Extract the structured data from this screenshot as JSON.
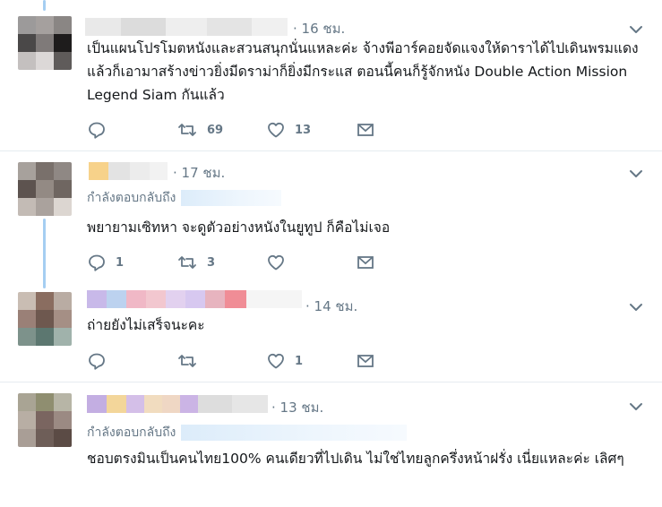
{
  "tweets": [
    {
      "time": "· 16 ชม.",
      "text": "เป็นแผนโปรโมตหนังและสวนสนุกนั่นแหละค่ะ จ้างพีอาร์คอยจัดแจงให้ดาราได้ไปเดินพรมแดง แล้วก็เอามาสร้างข่าวยิ่งมีดราม่าก็ยิ่งมีกระแส ตอนนี้คนก็รู้จักหนัง Double Action Mission Legend Siam กันแล้ว",
      "reply_to": "",
      "replies": "",
      "retweets": "69",
      "likes": "13",
      "avatar": [
        "#9c9a9a",
        "#a5a09e",
        "#8a8684",
        "#4a4848",
        "#7f7a79",
        "#1e1c1c",
        "#c4c0bf",
        "#dcd8d7",
        "#5f5b5a"
      ],
      "name_colors": [
        "#e9e9e9",
        "#dcdcdc",
        "#eeeeee",
        "#e4e4e4",
        "#f0f0f0"
      ]
    },
    {
      "time": "· 17 ชม.",
      "text": "พยายามเซิทหา จะดูตัวอย่างหนังในยูทูป ก็คือไม่เจอ",
      "reply_to": "กำลังตอบกลับถึง",
      "replies": "1",
      "retweets": "3",
      "likes": "",
      "avatar": [
        "#a7a19c",
        "#79706b",
        "#8f8884",
        "#5d534f",
        "#938a84",
        "#6f6661",
        "#c3bbb5",
        "#aaa29d",
        "#dcd6d1"
      ],
      "name_colors": [
        "#f7d28a",
        "#e3e3e3",
        "#ececec",
        "#f2f2f2"
      ]
    },
    {
      "time": "· 14 ชม.",
      "text": "ถ่ายยังไม่เสร็จนะคะ",
      "reply_to": "",
      "replies": "",
      "retweets": "",
      "likes": "1",
      "avatar": [
        "#c9bdb3",
        "#8a6d60",
        "#b9aca3",
        "#9a8077",
        "#6e584f",
        "#a58f85",
        "#7d928b",
        "#5c7770",
        "#a0b2ab"
      ],
      "name_colors": [
        "#c8b9e9",
        "#bcd2ef",
        "#f0b8c6",
        "#f2c7cf",
        "#e2d1ef",
        "#d7c8f0",
        "#e7b4bf",
        "#f08d96"
      ]
    },
    {
      "time": "· 13 ชม.",
      "text": "ชอบตรงมินเป็นคนไทย100% คนเดียวที่ไปเดิน ไม่ใช่ไทยลูกครึ่งหน้าฝรั่ง เนี่ยแหละค่ะ เลิศๆ",
      "reply_to": "กำลังตอบกลับถึง",
      "replies": "",
      "retweets": "",
      "likes": "",
      "avatar": [
        "#a9a494",
        "#8f8e70",
        "#b7b5a6",
        "#b8aea4",
        "#7a6560",
        "#9b8a83",
        "#a99e96",
        "#6e5e58",
        "#5b4b45"
      ],
      "name_colors": [
        "#c3aee2",
        "#f3d69a",
        "#d4bfe8",
        "#f1dcbf",
        "#efd7c4",
        "#cbb4e5",
        "#dddddd",
        "#e6e6e6"
      ]
    }
  ],
  "icons": {
    "reply": "reply-icon",
    "retweet": "retweet-icon",
    "like": "heart-icon",
    "dm": "envelope-icon",
    "menu": "chevron-down-icon"
  }
}
